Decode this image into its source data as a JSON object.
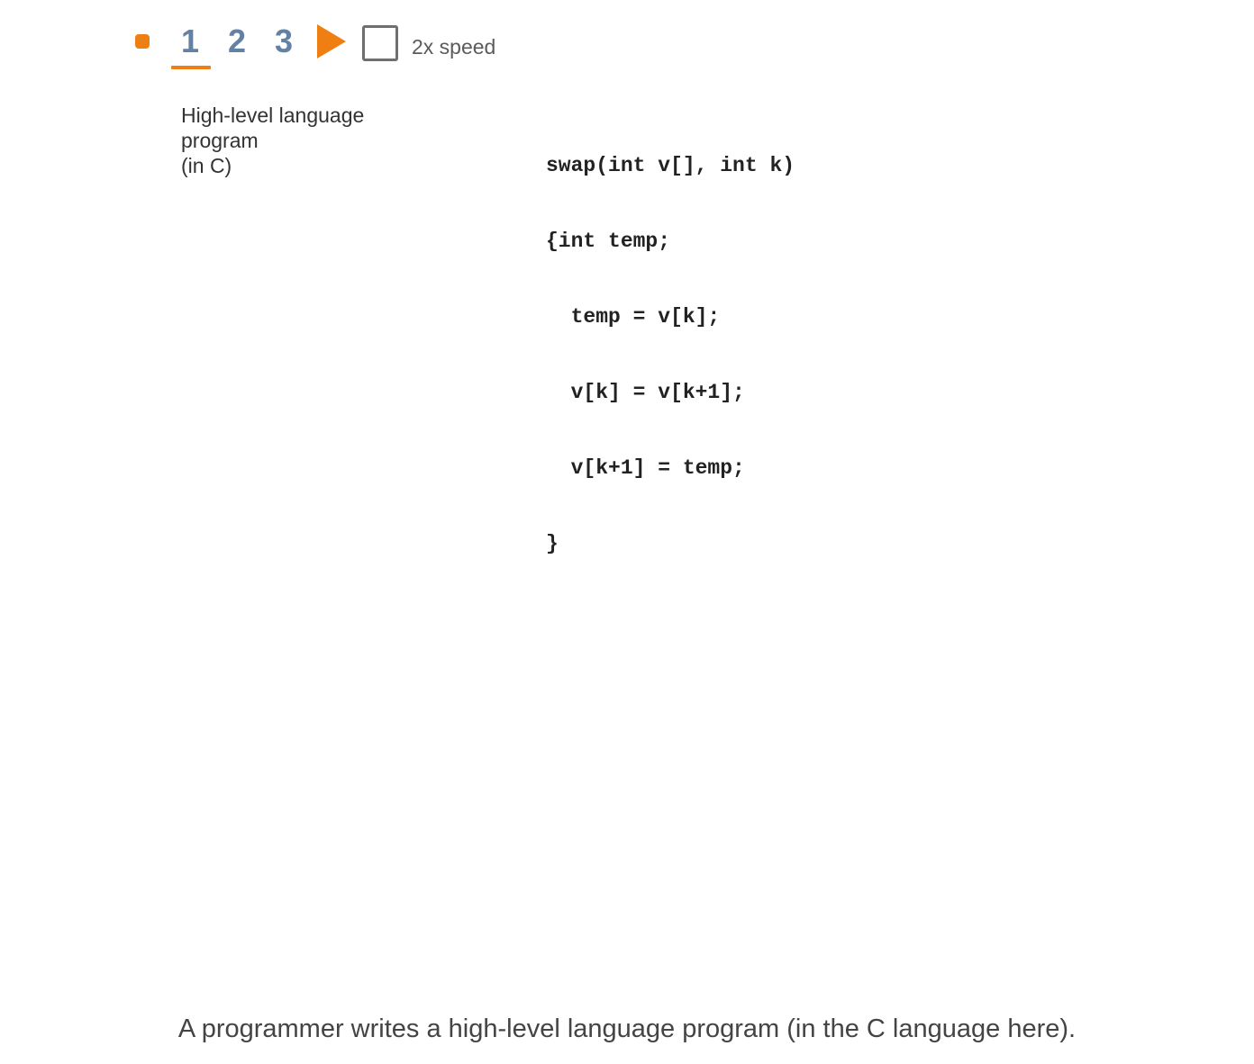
{
  "controls": {
    "steps": [
      "1",
      "2",
      "3"
    ],
    "speed_label": "2x speed",
    "speed_checked": false,
    "active_step": 1,
    "accent_color": "#f07f13",
    "step_color": "#6381a4"
  },
  "program_label": {
    "lines": [
      "High-level language",
      "program",
      "(in C)"
    ]
  },
  "code": {
    "lines": [
      "swap(int v[], int k)",
      "{int temp;",
      "  temp = v[k];",
      "  v[k] = v[k+1];",
      "  v[k+1] = temp;",
      "}"
    ]
  },
  "caption": "A programmer writes a high-level language program (in the C language here)."
}
